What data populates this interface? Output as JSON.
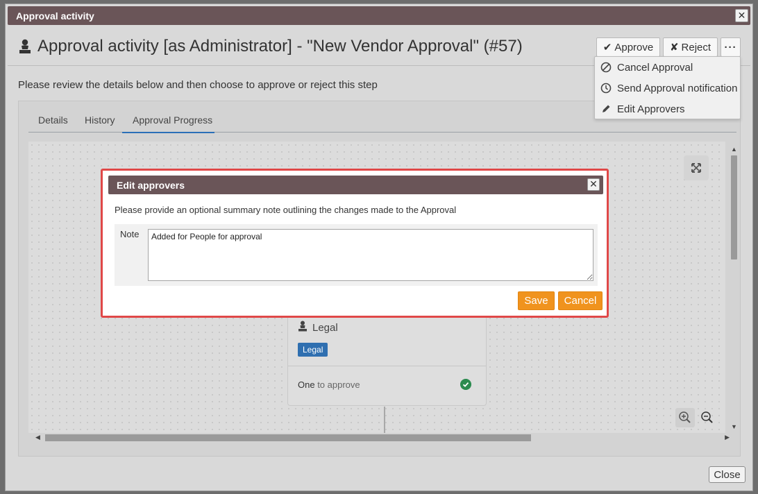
{
  "window": {
    "title": "Approval activity",
    "close_glyph": "✕",
    "heading": "Approval activity [as Administrator] - \"New Vendor Approval\" (#57)",
    "heading_icon": "user-icon"
  },
  "actions": {
    "approve_glyph": "✔",
    "approve_label": "Approve",
    "reject_glyph": "✘",
    "reject_label": "Reject",
    "more_label": "···"
  },
  "instructions": "Please review the details below and then choose to approve or reject this step",
  "tabs": [
    {
      "label": "Details"
    },
    {
      "label": "History"
    },
    {
      "label": "Approval Progress",
      "active": true
    }
  ],
  "flow_card": {
    "title": "Legal",
    "badge": "Legal",
    "footer_count": "One",
    "footer_rest": " to approve",
    "status": "approved"
  },
  "dropdown": {
    "items": [
      {
        "label": "Cancel Approval",
        "icon": "ban-icon"
      },
      {
        "label": "Send Approval notification",
        "icon": "clock-icon"
      },
      {
        "label": "Edit Approvers",
        "icon": "pencil-icon"
      }
    ]
  },
  "modal": {
    "title": "Edit approvers",
    "close_glyph": "✕",
    "description": "Please provide an optional summary note outlining the changes made to the Approval",
    "note_label": "Note",
    "note_value": "Added for People for approval",
    "save_label": "Save",
    "cancel_label": "Cancel"
  },
  "footer": {
    "close_label": "Close"
  },
  "colors": {
    "titlebar": "#6a5558",
    "accent_orange": "#f0931e",
    "badge_blue": "#2f6fb0",
    "tab_active": "#2a6fb8",
    "highlight_red": "#e04848",
    "check_green": "#2c8b4f"
  }
}
